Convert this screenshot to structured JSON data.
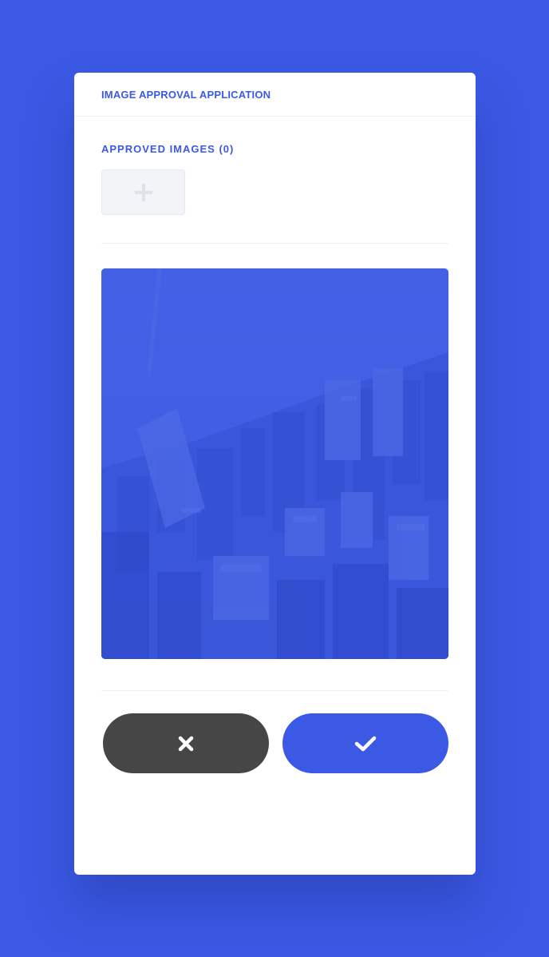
{
  "app": {
    "title": "IMAGE APPROVAL APPLICATION"
  },
  "approved": {
    "heading": "APPROVED IMAGES (0)",
    "count": 0,
    "add_icon": "plus-icon"
  },
  "preview": {
    "image_subject": "aerial city skyline photo with blue overlay"
  },
  "actions": {
    "reject_icon": "close-icon",
    "approve_icon": "check-icon"
  },
  "colors": {
    "background": "#3b59e4",
    "accent": "#3b59e4",
    "reject_button": "#464646",
    "card": "#ffffff"
  }
}
